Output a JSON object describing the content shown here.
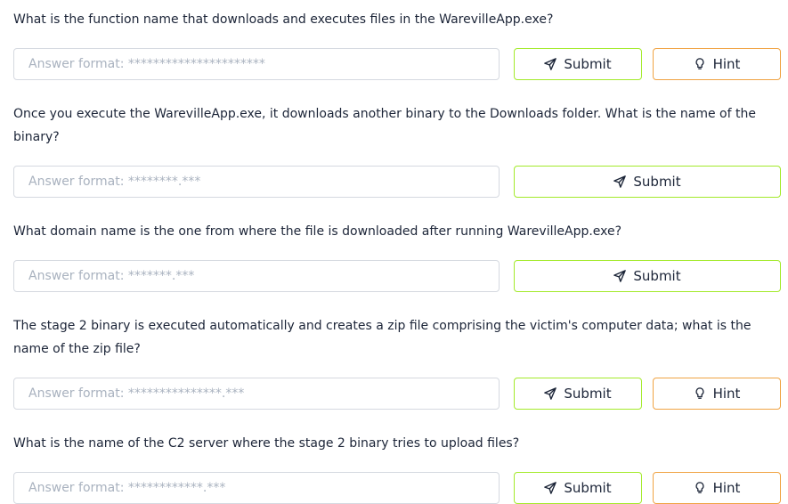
{
  "answer_placeholders": {
    "q1": "Answer format: **********************",
    "q2": "Answer format: ********.***",
    "q3": "Answer format: *******.***",
    "q4": "Answer format: ***************.***",
    "q5": "Answer format: ************.***"
  },
  "buttons": {
    "submit_label": "Submit",
    "hint_label": "Hint"
  },
  "icons": {
    "submit": "paper-plane-icon",
    "hint": "lightbulb-icon"
  },
  "colors": {
    "submit_border": "#a3ea2a",
    "hint_border": "#f0a343",
    "text": "#1c2538",
    "placeholder": "#a9b2bf"
  },
  "questions": [
    {
      "text": "What is the function name that downloads and executes files in the WarevilleApp.exe?"
    },
    {
      "text": "Once you execute the WarevilleApp.exe, it downloads another binary to the Downloads folder. What is the name of the binary?"
    },
    {
      "text": "What domain name is the one from where the file is downloaded after running WarevilleApp.exe?"
    },
    {
      "text": "The stage 2 binary is executed automatically and creates a zip file comprising the victim's computer data; what is the name of the zip file?"
    },
    {
      "text": "What is the name of the C2 server where the stage 2 binary tries to upload files?"
    }
  ]
}
